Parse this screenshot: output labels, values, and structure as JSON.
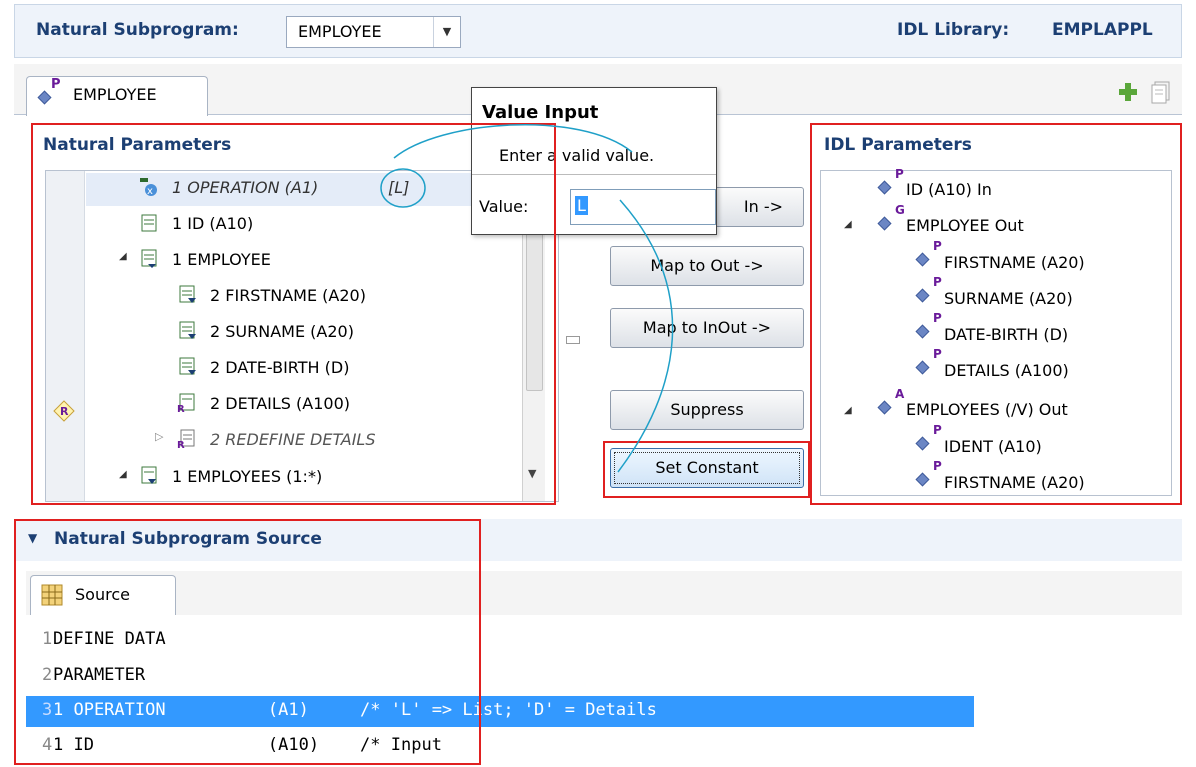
{
  "header": {
    "subprogram_label": "Natural Subprogram:",
    "subprogram_value": "EMPLOYEE",
    "library_label": "IDL Library:",
    "library_value": "EMPLAPPL"
  },
  "tab": {
    "label": "EMPLOYEE",
    "badge": "P"
  },
  "natural_params": {
    "title": "Natural Parameters",
    "items": [
      {
        "text": "1 OPERATION (A1)",
        "suffix": "[L]"
      },
      {
        "text": "1 ID (A10)"
      },
      {
        "text": "1 EMPLOYEE"
      },
      {
        "text": "2 FIRSTNAME (A20)"
      },
      {
        "text": "2 SURNAME (A20)"
      },
      {
        "text": "2 DATE-BIRTH (D)"
      },
      {
        "text": "2 DETAILS (A100)"
      },
      {
        "text": "2 REDEFINE DETAILS"
      },
      {
        "text": "1 EMPLOYEES (1:*)"
      }
    ]
  },
  "popup": {
    "title": "Value Input",
    "message": "Enter a valid value.",
    "value_label": "Value:",
    "value": "L"
  },
  "buttons": {
    "map_in": "In ->",
    "map_out": "Map to Out ->",
    "map_inout": "Map to InOut ->",
    "suppress": "Suppress",
    "set_constant": "Set Constant"
  },
  "idl_params": {
    "title": "IDL Parameters",
    "items": [
      {
        "badge": "P",
        "text": "ID  (A10) In"
      },
      {
        "badge": "G",
        "text": "EMPLOYEE  Out"
      },
      {
        "badge": "P",
        "text": "FIRSTNAME  (A20)"
      },
      {
        "badge": "P",
        "text": "SURNAME  (A20)"
      },
      {
        "badge": "P",
        "text": "DATE-BIRTH  (D)"
      },
      {
        "badge": "P",
        "text": "DETAILS  (A100)"
      },
      {
        "badge": "A",
        "text": "EMPLOYEES  (/V) Out"
      },
      {
        "badge": "P",
        "text": "IDENT  (A10)"
      },
      {
        "badge": "P",
        "text": "FIRSTNAME  (A20)"
      }
    ]
  },
  "source_section": {
    "title": "Natural Subprogram Source",
    "tab_label": "Source",
    "lines": [
      {
        "num": "1",
        "code": "DEFINE DATA"
      },
      {
        "num": "2",
        "code": "PARAMETER"
      },
      {
        "num": "3",
        "code": "1 OPERATION          (A1)     /* 'L' => List; 'D' = Details"
      },
      {
        "num": "4",
        "code": "1 ID                 (A10)    /* Input"
      }
    ]
  },
  "colors": {
    "accent": "#1c3f73",
    "selection": "#3399ff",
    "highlight_box": "#e02020",
    "callout_line": "#1fa0c8"
  }
}
